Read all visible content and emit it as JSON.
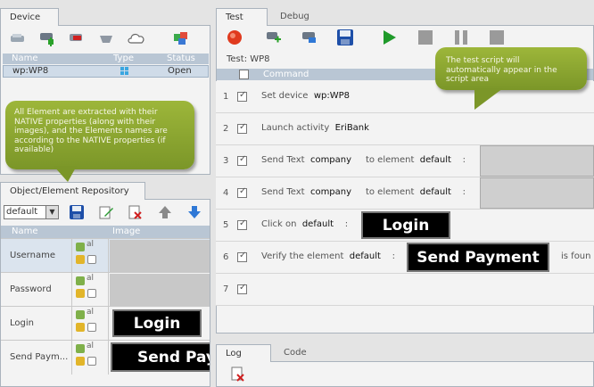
{
  "device_panel": {
    "tab": "Device",
    "columns": [
      "Name",
      "Type",
      "Status"
    ],
    "rows": [
      {
        "name": "wp:WP8",
        "type_icon": "windows-logo-icon",
        "status": "Open"
      }
    ]
  },
  "callout_left": "All Element are extracted with their NATIVE properties (along with their images), and the Elements names are according to the NATIVE properties (if available)",
  "callout_right": "The test script will automatically appear in the script area",
  "repository": {
    "tab": "Object/Element Repository",
    "dropdown_value": "default",
    "columns": [
      "Name",
      "Image"
    ],
    "rows": [
      {
        "name": "Username",
        "image_kind": "gray",
        "image_text": ""
      },
      {
        "name": "Password",
        "image_kind": "gray",
        "image_text": ""
      },
      {
        "name": "Login",
        "image_kind": "black",
        "image_text": "Login"
      },
      {
        "name": "Send Paym...",
        "image_kind": "black",
        "image_text": "Send Payn"
      }
    ]
  },
  "test_panel": {
    "tabs": [
      "Test",
      "Debug"
    ],
    "title": "Test: WP8",
    "command_header": "Command",
    "steps": [
      {
        "num": "1",
        "pre": "Set device",
        "arg1": "wp:WP8"
      },
      {
        "num": "2",
        "pre": "Launch activity",
        "arg1": "EriBank"
      },
      {
        "num": "3",
        "pre": "Send Text",
        "arg1": "company",
        "mid": "to element",
        "arg2": "default",
        "sep": ":"
      },
      {
        "num": "4",
        "pre": "Send Text",
        "arg1": "company",
        "mid": "to element",
        "arg2": "default",
        "sep": ":"
      },
      {
        "num": "5",
        "pre": "Click on",
        "arg1": "default",
        "sep": ":",
        "button": "Login"
      },
      {
        "num": "6",
        "pre": "Verify the element",
        "arg1": "default",
        "sep": ":",
        "button": "Send Payment",
        "post": "is foun"
      },
      {
        "num": "7"
      }
    ]
  },
  "bottom_panel": {
    "tabs": [
      "Log",
      "Code"
    ]
  }
}
